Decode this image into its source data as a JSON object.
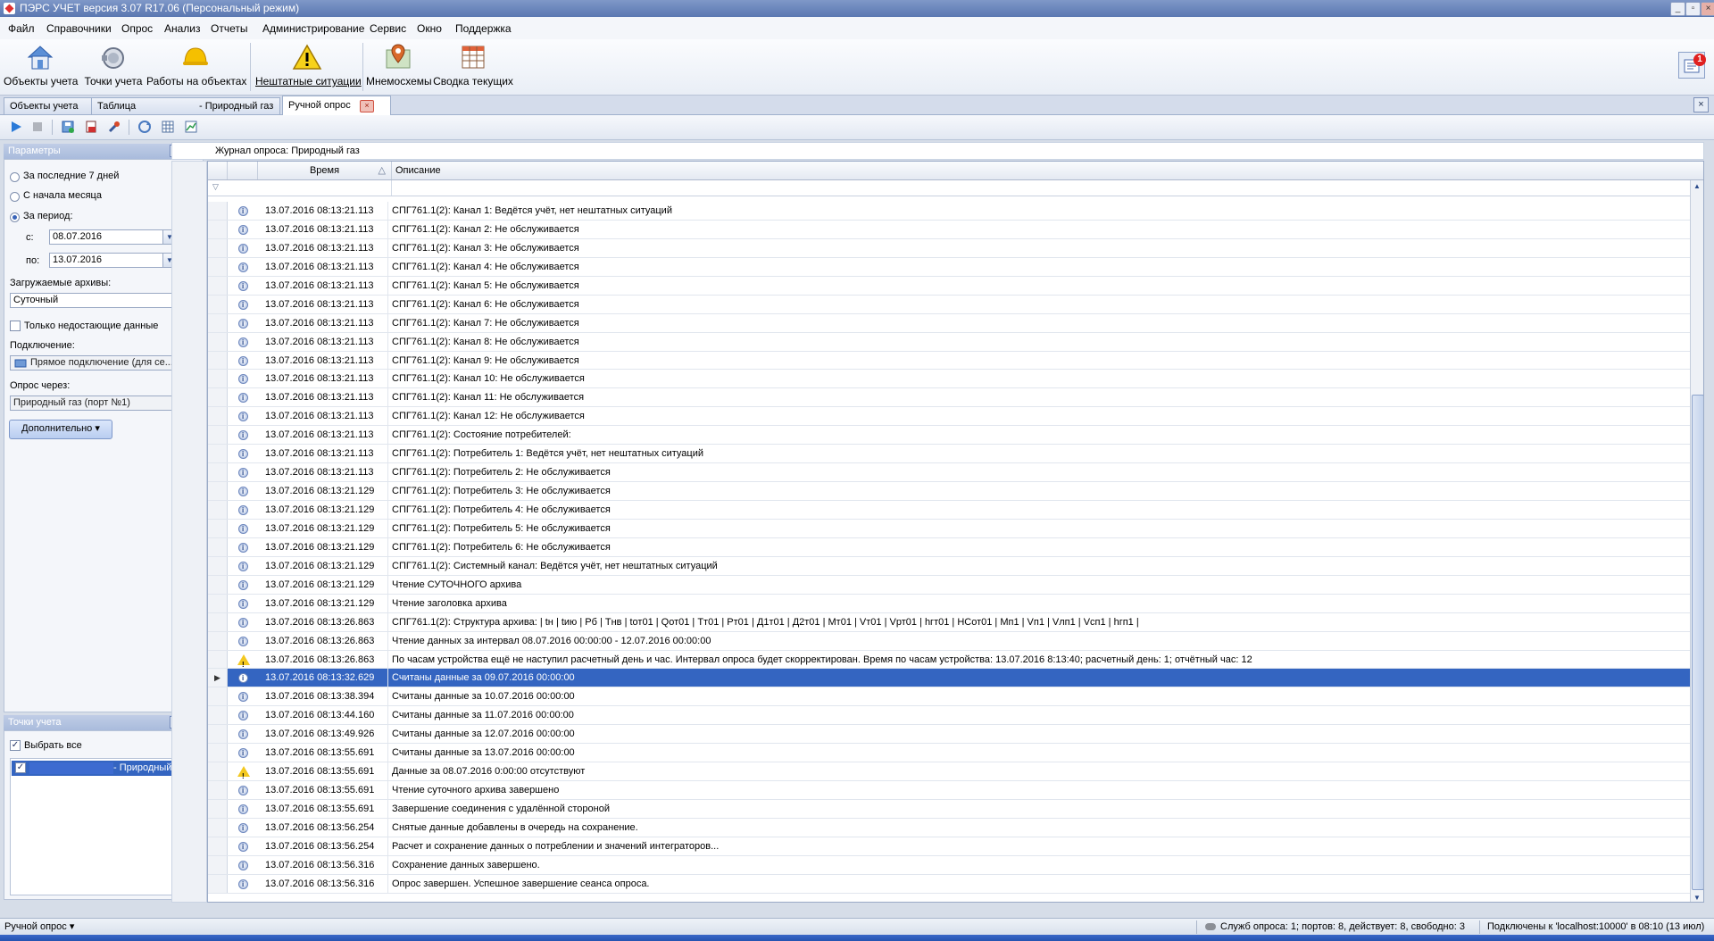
{
  "window": {
    "title": "ПЭРС УЧЕТ версия 3.07 R17.06 (Персональный режим)"
  },
  "menu": [
    "Файл",
    "Справочники",
    "Опрос",
    "Анализ",
    "Отчеты",
    "Администрирование",
    "Сервис",
    "Окно",
    "Поддержка"
  ],
  "ribbon": {
    "objects": "Объекты учета",
    "points": "Точки учета",
    "works": "Работы на объектах",
    "emergency": "Нештатные ситуации",
    "mnemo": "Мнемосхемы",
    "summary": "Сводка текущих",
    "alerts_count": "1"
  },
  "tabs": {
    "objects": "Объекты учета",
    "table": "Таблица",
    "table_suffix": "- Природный газ",
    "manual": "Ручной опрос"
  },
  "params": {
    "header": "Параметры",
    "last7": "За последние 7 дней",
    "month_start": "С начала месяца",
    "period": "За период:",
    "from_label": "с:",
    "from_value": "08.07.2016",
    "to_label": "по:",
    "to_value": "13.07.2016",
    "archives_label": "Загружаемые архивы:",
    "archives_value": "Суточный",
    "missing_only": "Только недостающие данные",
    "connection_label": "Подключение:",
    "connection_value": "Прямое подключение (для се...",
    "via_label": "Опрос через:",
    "via_value": "Природный газ (порт №1)",
    "more_button": "Дополнительно"
  },
  "points": {
    "header": "Точки учета",
    "select_all": "Выбрать все",
    "item_suffix": "- Природный газ"
  },
  "journal": {
    "title": "Журнал опроса: Природный газ",
    "col_time": "Время",
    "col_desc": "Описание",
    "rows": [
      {
        "icon": "info",
        "time": "13.07.2016 08:13:21.113",
        "desc": "СПГ761.1(2): Канал 1: Ведётся учёт, нет нештатных ситуаций"
      },
      {
        "icon": "info",
        "time": "13.07.2016 08:13:21.113",
        "desc": "СПГ761.1(2): Канал 2: Не обслуживается"
      },
      {
        "icon": "info",
        "time": "13.07.2016 08:13:21.113",
        "desc": "СПГ761.1(2): Канал 3: Не обслуживается"
      },
      {
        "icon": "info",
        "time": "13.07.2016 08:13:21.113",
        "desc": "СПГ761.1(2): Канал 4: Не обслуживается"
      },
      {
        "icon": "info",
        "time": "13.07.2016 08:13:21.113",
        "desc": "СПГ761.1(2): Канал 5: Не обслуживается"
      },
      {
        "icon": "info",
        "time": "13.07.2016 08:13:21.113",
        "desc": "СПГ761.1(2): Канал 6: Не обслуживается"
      },
      {
        "icon": "info",
        "time": "13.07.2016 08:13:21.113",
        "desc": "СПГ761.1(2): Канал 7: Не обслуживается"
      },
      {
        "icon": "info",
        "time": "13.07.2016 08:13:21.113",
        "desc": "СПГ761.1(2): Канал 8: Не обслуживается"
      },
      {
        "icon": "info",
        "time": "13.07.2016 08:13:21.113",
        "desc": "СПГ761.1(2): Канал 9: Не обслуживается"
      },
      {
        "icon": "info",
        "time": "13.07.2016 08:13:21.113",
        "desc": "СПГ761.1(2): Канал 10: Не обслуживается"
      },
      {
        "icon": "info",
        "time": "13.07.2016 08:13:21.113",
        "desc": "СПГ761.1(2): Канал 11: Не обслуживается"
      },
      {
        "icon": "info",
        "time": "13.07.2016 08:13:21.113",
        "desc": "СПГ761.1(2): Канал 12: Не обслуживается"
      },
      {
        "icon": "info",
        "time": "13.07.2016 08:13:21.113",
        "desc": "СПГ761.1(2): Состояние потребителей:"
      },
      {
        "icon": "info",
        "time": "13.07.2016 08:13:21.113",
        "desc": "СПГ761.1(2): Потребитель 1: Ведётся учёт, нет нештатных ситуаций"
      },
      {
        "icon": "info",
        "time": "13.07.2016 08:13:21.113",
        "desc": "СПГ761.1(2): Потребитель 2: Не обслуживается"
      },
      {
        "icon": "info",
        "time": "13.07.2016 08:13:21.129",
        "desc": "СПГ761.1(2): Потребитель 3: Не обслуживается"
      },
      {
        "icon": "info",
        "time": "13.07.2016 08:13:21.129",
        "desc": "СПГ761.1(2): Потребитель 4: Не обслуживается"
      },
      {
        "icon": "info",
        "time": "13.07.2016 08:13:21.129",
        "desc": "СПГ761.1(2): Потребитель 5: Не обслуживается"
      },
      {
        "icon": "info",
        "time": "13.07.2016 08:13:21.129",
        "desc": "СПГ761.1(2): Потребитель 6: Не обслуживается"
      },
      {
        "icon": "info",
        "time": "13.07.2016 08:13:21.129",
        "desc": "СПГ761.1(2): Системный канал: Ведётся учёт, нет нештатных ситуаций"
      },
      {
        "icon": "info",
        "time": "13.07.2016 08:13:21.129",
        "desc": "Чтение СУТОЧНОГО архива"
      },
      {
        "icon": "info",
        "time": "13.07.2016 08:13:21.129",
        "desc": "Чтение заголовка архива"
      },
      {
        "icon": "info",
        "time": "13.07.2016 08:13:26.863",
        "desc": "СПГ761.1(2): Структура архива:  | tн | tию | Рб | Тнв | tот01 | Qот01 | Тт01 | Рт01 | Д1т01 | Д2т01 | Мт01 | Vт01 | Vрт01 | hгт01 | НСот01 | Mп1 | Vп1 | Vлп1 | Vcп1 | hгп1 |"
      },
      {
        "icon": "info",
        "time": "13.07.2016 08:13:26.863",
        "desc": "Чтение данных за интервал 08.07.2016 00:00:00 - 12.07.2016 00:00:00"
      },
      {
        "icon": "warn",
        "time": "13.07.2016 08:13:26.863",
        "desc": "По часам устройства ещё не наступил расчетный день и час. Интервал опроса будет скорректирован. Время по часам устройства: 13.07.2016 8:13:40; расчетный день: 1; отчётный час: 12"
      },
      {
        "icon": "info",
        "time": "13.07.2016 08:13:32.629",
        "desc": "Считаны данные за 09.07.2016 00:00:00",
        "selected": true
      },
      {
        "icon": "info",
        "time": "13.07.2016 08:13:38.394",
        "desc": "Считаны данные за 10.07.2016 00:00:00"
      },
      {
        "icon": "info",
        "time": "13.07.2016 08:13:44.160",
        "desc": "Считаны данные за 11.07.2016 00:00:00"
      },
      {
        "icon": "info",
        "time": "13.07.2016 08:13:49.926",
        "desc": "Считаны данные за 12.07.2016 00:00:00"
      },
      {
        "icon": "info",
        "time": "13.07.2016 08:13:55.691",
        "desc": "Считаны данные за 13.07.2016 00:00:00"
      },
      {
        "icon": "warn",
        "time": "13.07.2016 08:13:55.691",
        "desc": "Данные за 08.07.2016 0:00:00 отсутствуют"
      },
      {
        "icon": "info",
        "time": "13.07.2016 08:13:55.691",
        "desc": "Чтение суточного архива завершено"
      },
      {
        "icon": "info",
        "time": "13.07.2016 08:13:55.691",
        "desc": "Завершение соединения с удалённой стороной"
      },
      {
        "icon": "info",
        "time": "13.07.2016 08:13:56.254",
        "desc": "Снятые данные добавлены в очередь на сохранение."
      },
      {
        "icon": "info",
        "time": "13.07.2016 08:13:56.254",
        "desc": "Расчет и сохранение данных о потреблении и значений интеграторов..."
      },
      {
        "icon": "info",
        "time": "13.07.2016 08:13:56.316",
        "desc": "Сохранение данных завершено."
      },
      {
        "icon": "info",
        "time": "13.07.2016 08:13:56.316",
        "desc": "Опрос завершен. Успешное завершение сеанса опроса."
      }
    ]
  },
  "status": {
    "left": "Ручной опрос",
    "services": "Служб опроса: 1; портов: 8, действует: 8, свободно: 3",
    "connected": "Подключены к 'localhost:10000' в 08:10 (13 июл)"
  },
  "colors": {
    "selection": "#3465c1",
    "panel_header": "#a9bbdc",
    "warning": "#f3c820"
  }
}
